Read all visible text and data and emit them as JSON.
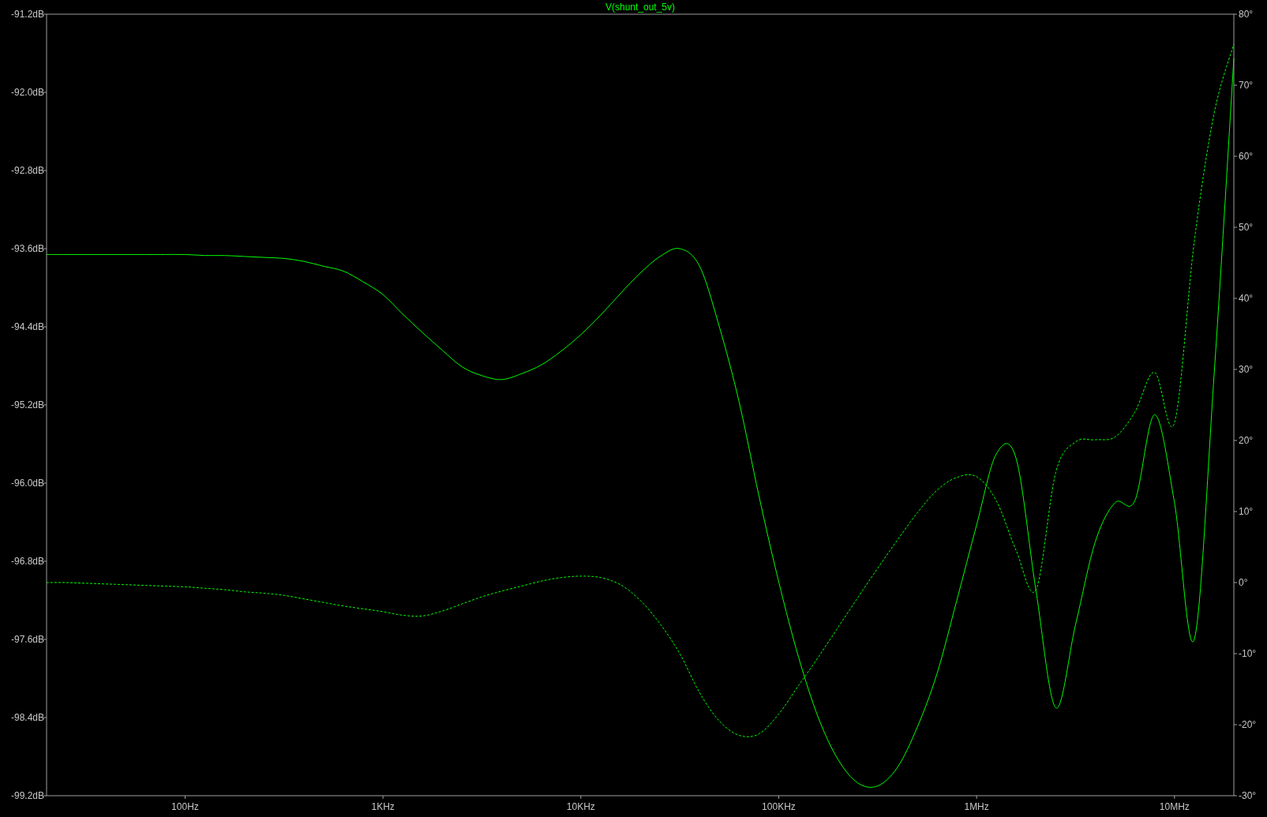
{
  "plot": {
    "charts": [
      {
        "chart_data": {
          "type": "line",
          "title": "V(shunt_out_5v)",
          "categories": [
            null,
            null,
            null,
            null,
            null,
            null,
            null,
            "100Hz",
            null,
            null,
            null,
            null,
            null,
            null,
            null,
            null,
            null,
            "1KHz",
            null,
            null,
            null,
            null,
            null,
            null,
            null,
            null,
            null,
            "10KHz",
            null,
            null,
            null,
            null,
            null,
            null,
            null,
            null,
            null,
            "100KHz",
            null,
            null,
            null,
            null,
            null,
            null,
            null,
            null,
            null,
            "1MHz",
            null,
            null,
            null,
            null,
            null,
            null,
            null,
            null,
            null,
            "10MHz",
            null,
            null,
            null
          ],
          "ylim": [
            -99.2,
            -91.2
          ],
          "yticks": [
            {
              "value": -91.2,
              "label": "-91.2dB"
            },
            {
              "value": -92.0,
              "label": "-92.0dB"
            },
            {
              "value": -92.8,
              "label": "-92.8dB"
            },
            {
              "value": -93.6,
              "label": "-93.6dB"
            },
            {
              "value": -94.4,
              "label": "-94.4dB"
            },
            {
              "value": -95.2,
              "label": "-95.2dB"
            },
            {
              "value": -96.0,
              "label": "-96.0dB"
            },
            {
              "value": -96.8,
              "label": "-96.8dB"
            },
            {
              "value": -97.6,
              "label": "-97.6dB"
            },
            {
              "value": -98.4,
              "label": "-98.4dB"
            },
            {
              "value": -99.2,
              "label": "-99.2dB"
            }
          ],
          "series": [
            {
              "color": "#00ff00",
              "line_style": "solid",
              "values": [
                -93.66,
                -93.66,
                -93.66,
                -93.66,
                -93.66,
                -93.66,
                -93.66,
                -93.66,
                -93.67,
                -93.67,
                -93.68,
                -93.69,
                -93.7,
                -93.73,
                -93.78,
                -93.83,
                -93.94,
                -94.07,
                -94.27,
                -94.46,
                -94.64,
                -94.81,
                -94.9,
                -94.94,
                -94.88,
                -94.79,
                -94.65,
                -94.48,
                -94.28,
                -94.06,
                -93.85,
                -93.68,
                -93.6,
                -93.78,
                -94.4,
                -95.17,
                -96.13,
                -97.01,
                -97.78,
                -98.4,
                -98.83,
                -99.07,
                -99.1,
                -98.91,
                -98.5,
                -97.95,
                -97.2,
                -96.43,
                -95.7,
                -95.75,
                -97.1,
                -98.3,
                -97.45,
                -96.6,
                -96.2,
                -96.18,
                -95.3,
                -96.2,
                -97.6,
                -94.9,
                -91.65
              ]
            }
          ]
        }
      },
      {
        "chart_data": {
          "type": "line",
          "categories": [
            null,
            null,
            null,
            null,
            null,
            null,
            null,
            null,
            null,
            null,
            null,
            null,
            null,
            null,
            null,
            null,
            null,
            null,
            null,
            null,
            null,
            null,
            null,
            null,
            null,
            null,
            null,
            null,
            null,
            null,
            null,
            null,
            null,
            null,
            null,
            null,
            null,
            null,
            null,
            null,
            null,
            null,
            null,
            null,
            null,
            null,
            null,
            null,
            null,
            null,
            null,
            null,
            null,
            null,
            null,
            null,
            null,
            null,
            null,
            null,
            null
          ],
          "ylim": [
            -30,
            80
          ],
          "yticks": [
            {
              "value": 80,
              "label": "80°"
            },
            {
              "value": 70,
              "label": "70°"
            },
            {
              "value": 60,
              "label": "60°"
            },
            {
              "value": 50,
              "label": "50°"
            },
            {
              "value": 40,
              "label": "40°"
            },
            {
              "value": 30,
              "label": "30°"
            },
            {
              "value": 20,
              "label": "20°"
            },
            {
              "value": 10,
              "label": "10°"
            },
            {
              "value": 0,
              "label": "0°"
            },
            {
              "value": -10,
              "label": "-10°"
            },
            {
              "value": -20,
              "label": "-20°"
            },
            {
              "value": -30,
              "label": "-30°"
            }
          ],
          "series": [
            {
              "color": "#00ff00",
              "line_style": "dashed",
              "values": [
                0,
                0,
                -0.1,
                -0.2,
                -0.3,
                -0.4,
                -0.5,
                -0.6,
                -0.8,
                -1.0,
                -1.3,
                -1.5,
                -1.8,
                -2.3,
                -2.8,
                -3.3,
                -3.7,
                -4.1,
                -4.6,
                -4.7,
                -4.0,
                -3.0,
                -2.0,
                -1.2,
                -0.5,
                0.2,
                0.7,
                0.9,
                0.7,
                -0.3,
                -2.5,
                -5.8,
                -10.0,
                -15.5,
                -19.5,
                -21.5,
                -21.3,
                -18.5,
                -14.5,
                -10.5,
                -6.3,
                -2.1,
                2.0,
                6.0,
                9.8,
                13.0,
                14.8,
                14.9,
                11.5,
                4.5,
                -1.0,
                15.5,
                19.8,
                20.1,
                20.5,
                24.0,
                29.6,
                22.5,
                48.0,
                66.0,
                75.8
              ]
            }
          ]
        }
      }
    ]
  }
}
